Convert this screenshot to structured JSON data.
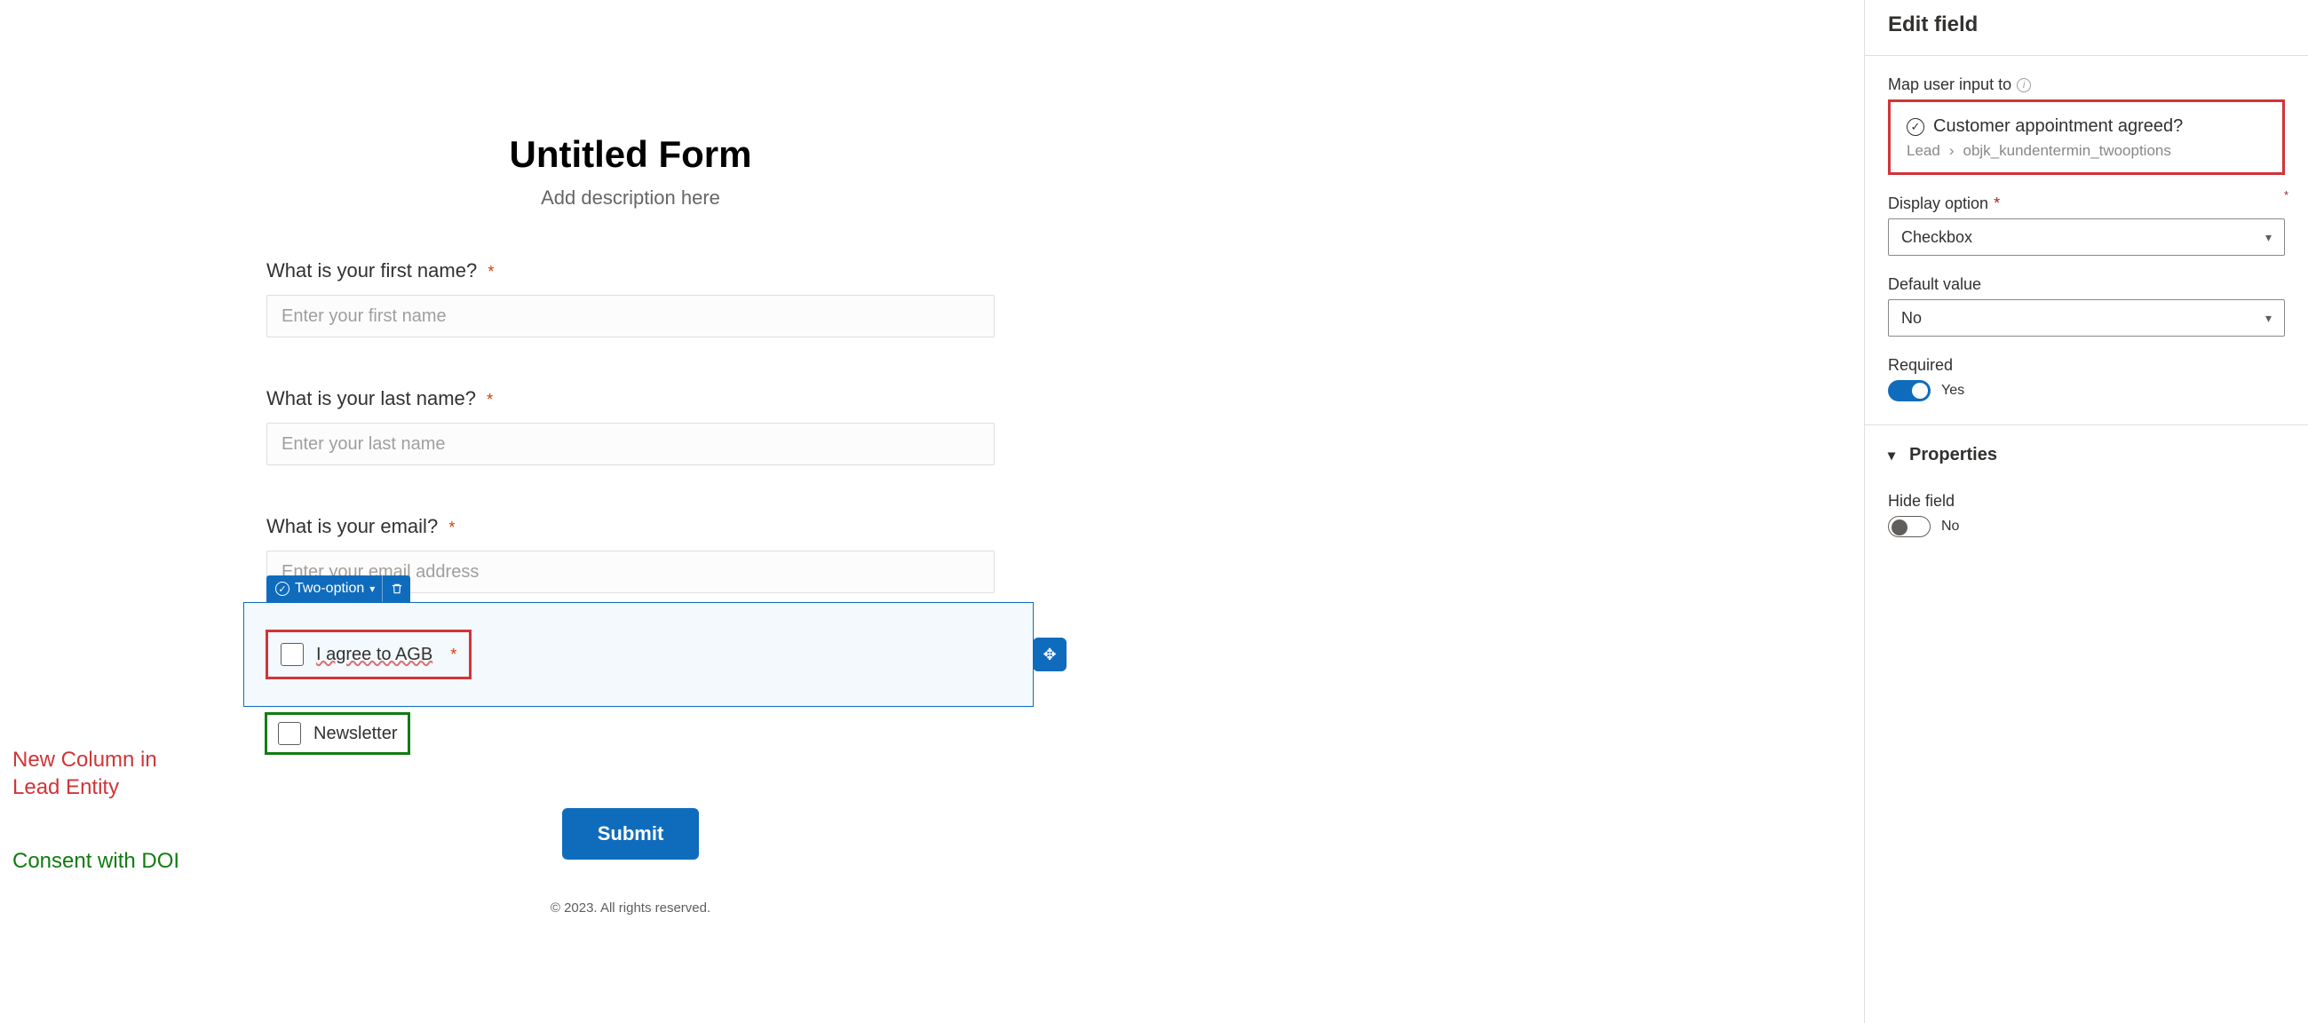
{
  "form": {
    "title": "Untitled Form",
    "description": "Add description here",
    "fields": {
      "first_name": {
        "label": "What is your first name?",
        "placeholder": "Enter your first name"
      },
      "last_name": {
        "label": "What is your last name?",
        "placeholder": "Enter your last name"
      },
      "email": {
        "label": "What is your email?",
        "placeholder": "Enter your email address"
      }
    },
    "two_option_tag": "Two-option",
    "agb": {
      "label": "I agree to AGB"
    },
    "newsletter": {
      "label": "Newsletter"
    },
    "submit": "Submit",
    "footer": "© 2023. All rights reserved."
  },
  "annotations": {
    "red": "New Column in Lead Entity",
    "green": "Consent with DOI"
  },
  "panel": {
    "title": "Edit field",
    "map_label": "Map user input to",
    "map_name": "Customer appointment agreed?",
    "map_path_entity": "Lead",
    "map_path_field": "objk_kundentermin_twooptions",
    "display_option_label": "Display option",
    "display_option_value": "Checkbox",
    "default_value_label": "Default value",
    "default_value_value": "No",
    "required_label": "Required",
    "required_value": "Yes",
    "properties_label": "Properties",
    "hide_field_label": "Hide field",
    "hide_field_value": "No"
  }
}
